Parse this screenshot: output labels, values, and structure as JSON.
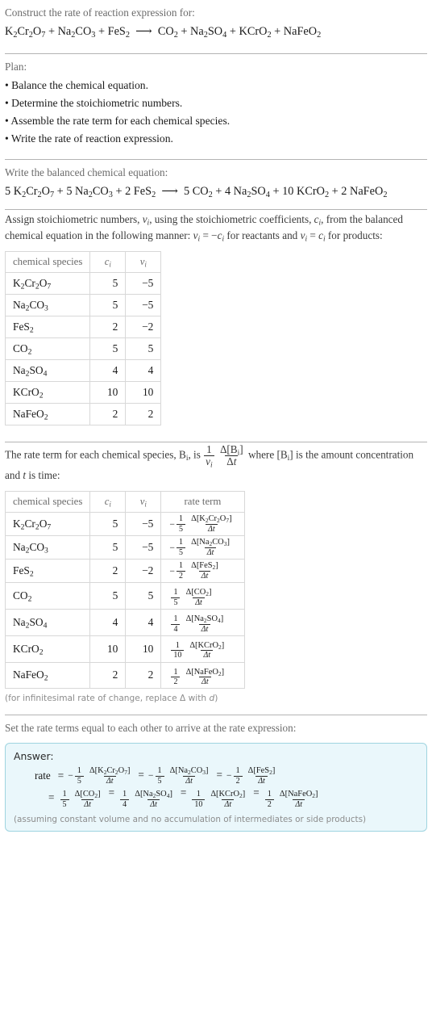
{
  "header": {
    "prompt": "Construct the rate of reaction expression for:",
    "reaction_html": "K<sub>2</sub>Cr<sub>2</sub>O<sub>7</sub> + Na<sub>2</sub>CO<sub>3</sub> + FeS<sub>2</sub> &nbsp;⟶&nbsp; CO<sub>2</sub> + Na<sub>2</sub>SO<sub>4</sub> + KCrO<sub>2</sub> + NaFeO<sub>2</sub>"
  },
  "plan": {
    "title": "Plan:",
    "steps": [
      "• Balance the chemical equation.",
      "• Determine the stoichiometric numbers.",
      "• Assemble the rate term for each chemical species.",
      "• Write the rate of reaction expression."
    ]
  },
  "balanced": {
    "title": "Write the balanced chemical equation:",
    "equation_html": "5 K<sub>2</sub>Cr<sub>2</sub>O<sub>7</sub> + 5 Na<sub>2</sub>CO<sub>3</sub> + 2 FeS<sub>2</sub> &nbsp;⟶&nbsp; 5 CO<sub>2</sub> + 4 Na<sub>2</sub>SO<sub>4</sub> + 10 KCrO<sub>2</sub> + 2 NaFeO<sub>2</sub>"
  },
  "assign": {
    "paragraph_html": "Assign stoichiometric numbers, <span class=\"sym\">ν<sub>i</sub></span>, using the stoichiometric coefficients, <span class=\"sym\">c<sub>i</sub></span>, from the balanced chemical equation in the following manner: <span class=\"sym\">ν<sub>i</sub></span> = &minus;<span class=\"sym\">c<sub>i</sub></span> for reactants and <span class=\"sym\">ν<sub>i</sub></span> = <span class=\"sym\">c<sub>i</sub></span> for products:"
  },
  "stoich_table": {
    "headers": [
      "chemical species",
      "c_i",
      "v_i"
    ],
    "rows": [
      {
        "species_html": "K<sub>2</sub>Cr<sub>2</sub>O<sub>7</sub>",
        "c": "5",
        "v": "−5"
      },
      {
        "species_html": "Na<sub>2</sub>CO<sub>3</sub>",
        "c": "5",
        "v": "−5"
      },
      {
        "species_html": "FeS<sub>2</sub>",
        "c": "2",
        "v": "−2"
      },
      {
        "species_html": "CO<sub>2</sub>",
        "c": "5",
        "v": "5"
      },
      {
        "species_html": "Na<sub>2</sub>SO<sub>4</sub>",
        "c": "4",
        "v": "4"
      },
      {
        "species_html": "KCrO<sub>2</sub>",
        "c": "10",
        "v": "10"
      },
      {
        "species_html": "NaFeO<sub>2</sub>",
        "c": "2",
        "v": "2"
      }
    ]
  },
  "rateterm_intro": {
    "paragraph_html": "The rate term for each chemical species, B<sub>i</sub>, is <span class=\"frac\"><span class=\"num\">1</span><span class=\"den sym\">ν<sub>i</sub></span></span> <span class=\"frac\"><span class=\"num\">Δ[B<sub>i</sub>]</span><span class=\"den\">Δ<span class=\"it\">t</span></span></span> where [B<sub>i</sub>] is the amount concentration and <span class=\"it\">t</span> is time:"
  },
  "rate_table": {
    "headers": [
      "chemical species",
      "c_i",
      "v_i",
      "rate term"
    ],
    "rows": [
      {
        "species_html": "K<sub>2</sub>Cr<sub>2</sub>O<sub>7</sub>",
        "c": "5",
        "v": "−5",
        "sign": "−",
        "coef": "1",
        "denom": "5",
        "delta_html": "Δ[K<sub>2</sub>Cr<sub>2</sub>O<sub>7</sub>]"
      },
      {
        "species_html": "Na<sub>2</sub>CO<sub>3</sub>",
        "c": "5",
        "v": "−5",
        "sign": "−",
        "coef": "1",
        "denom": "5",
        "delta_html": "Δ[Na<sub>2</sub>CO<sub>3</sub>]"
      },
      {
        "species_html": "FeS<sub>2</sub>",
        "c": "2",
        "v": "−2",
        "sign": "−",
        "coef": "1",
        "denom": "2",
        "delta_html": "Δ[FeS<sub>2</sub>]"
      },
      {
        "species_html": "CO<sub>2</sub>",
        "c": "5",
        "v": "5",
        "sign": "",
        "coef": "1",
        "denom": "5",
        "delta_html": "Δ[CO<sub>2</sub>]"
      },
      {
        "species_html": "Na<sub>2</sub>SO<sub>4</sub>",
        "c": "4",
        "v": "4",
        "sign": "",
        "coef": "1",
        "denom": "4",
        "delta_html": "Δ[Na<sub>2</sub>SO<sub>4</sub>]"
      },
      {
        "species_html": "KCrO<sub>2</sub>",
        "c": "10",
        "v": "10",
        "sign": "",
        "coef": "1",
        "denom": "10",
        "delta_html": "Δ[KCrO<sub>2</sub>]"
      },
      {
        "species_html": "NaFeO<sub>2</sub>",
        "c": "2",
        "v": "2",
        "sign": "",
        "coef": "1",
        "denom": "2",
        "delta_html": "Δ[NaFeO<sub>2</sub>]"
      }
    ],
    "footnote_html": "(for infinitesimal rate of change, replace Δ with <span class=\"it\">d</span>)"
  },
  "final": {
    "intro": "Set the rate terms equal to each other to arrive at the rate expression:",
    "answer_label": "Answer:",
    "rate_label": "rate",
    "terms_line1": [
      {
        "sign": "−",
        "coef": "1",
        "denom": "5",
        "delta_html": "Δ[K<sub>2</sub>Cr<sub>2</sub>O<sub>7</sub>]"
      },
      {
        "sign": "−",
        "coef": "1",
        "denom": "5",
        "delta_html": "Δ[Na<sub>2</sub>CO<sub>3</sub>]"
      },
      {
        "sign": "−",
        "coef": "1",
        "denom": "2",
        "delta_html": "Δ[FeS<sub>2</sub>]"
      }
    ],
    "terms_line2": [
      {
        "sign": "",
        "coef": "1",
        "denom": "5",
        "delta_html": "Δ[CO<sub>2</sub>]"
      },
      {
        "sign": "",
        "coef": "1",
        "denom": "4",
        "delta_html": "Δ[Na<sub>2</sub>SO<sub>4</sub>]"
      },
      {
        "sign": "",
        "coef": "1",
        "denom": "10",
        "delta_html": "Δ[KCrO<sub>2</sub>]"
      },
      {
        "sign": "",
        "coef": "1",
        "denom": "2",
        "delta_html": "Δ[NaFeO<sub>2</sub>]"
      }
    ],
    "assumption": "(assuming constant volume and no accumulation of intermediates or side products)",
    "equals": "=",
    "delta_t": "Δt"
  },
  "colors": {
    "answer_bg": "#eaf7fb",
    "answer_border": "#9fd4e0",
    "rule": "#b4b4b4",
    "table_border": "#d8d8d8"
  }
}
